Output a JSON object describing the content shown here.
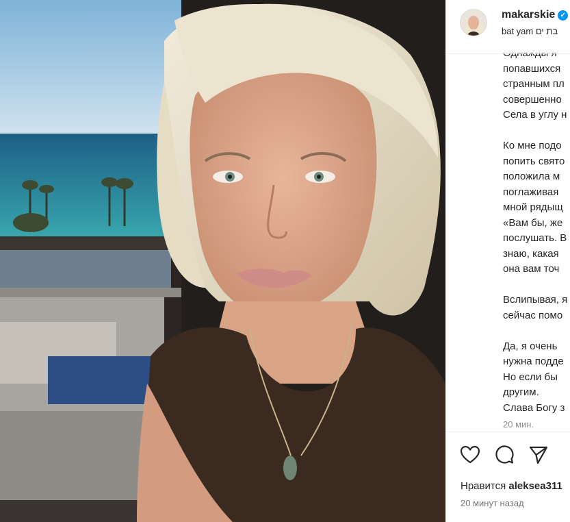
{
  "post": {
    "username": "makarskie",
    "location": "bat yam בת ים",
    "caption_lines_p1": [
      "Однажды я",
      "попавшихся",
      "странным пл",
      "совершенно",
      "Села в углу н"
    ],
    "caption_lines_p2": [
      "Ко мне подо",
      "попить свято",
      "положила м",
      "поглаживая",
      "мной рядыщ",
      "«Вам бы, же",
      "послушать. В",
      "знаю, какая",
      "она вам точ"
    ],
    "caption_lines_p3": [
      "Вслипывая, я",
      "сейчас помо"
    ],
    "caption_lines_p4": [
      "Да, я очень",
      "нужна подде",
      "Но если бы",
      "другим.",
      "Слава Богу з"
    ],
    "caption_time": "20 мин.",
    "likes_prefix": "Нравится",
    "likes_user": "aleksea311",
    "post_time": "20 минут назад"
  },
  "colors": {
    "text": "#262626",
    "secondary": "#8e8e8e",
    "verified": "#0095f6",
    "divider": "#efefef"
  },
  "icons": {
    "like": "heart-icon",
    "comment": "comment-icon",
    "share": "paper-plane-icon",
    "verified": "verified-badge-icon"
  }
}
